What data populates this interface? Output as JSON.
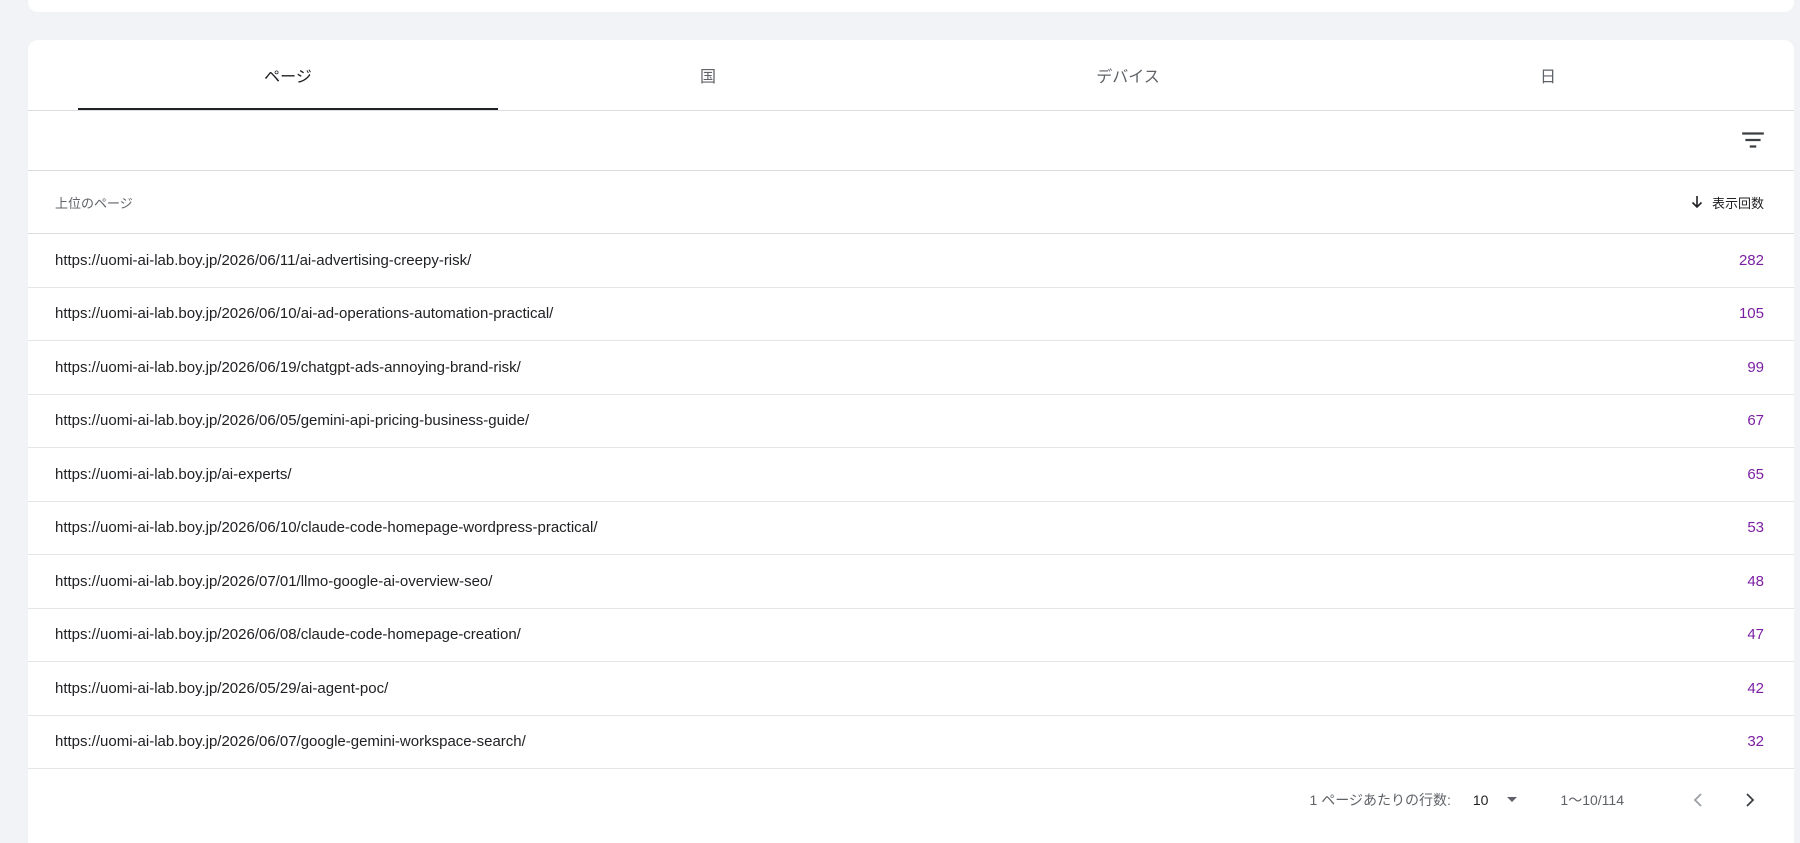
{
  "tabs": [
    {
      "label": "ページ",
      "active": true
    },
    {
      "label": "国",
      "active": false
    },
    {
      "label": "デバイス",
      "active": false
    },
    {
      "label": "日",
      "active": false
    }
  ],
  "table": {
    "column_page": "上位のページ",
    "column_metric": "表示回数",
    "rows": [
      {
        "url": "https://uomi-ai-lab.boy.jp/2026/06/11/ai-advertising-creepy-risk/",
        "value": "282"
      },
      {
        "url": "https://uomi-ai-lab.boy.jp/2026/06/10/ai-ad-operations-automation-practical/",
        "value": "105"
      },
      {
        "url": "https://uomi-ai-lab.boy.jp/2026/06/19/chatgpt-ads-annoying-brand-risk/",
        "value": "99"
      },
      {
        "url": "https://uomi-ai-lab.boy.jp/2026/06/05/gemini-api-pricing-business-guide/",
        "value": "67"
      },
      {
        "url": "https://uomi-ai-lab.boy.jp/ai-experts/",
        "value": "65"
      },
      {
        "url": "https://uomi-ai-lab.boy.jp/2026/06/10/claude-code-homepage-wordpress-practical/",
        "value": "53"
      },
      {
        "url": "https://uomi-ai-lab.boy.jp/2026/07/01/llmo-google-ai-overview-seo/",
        "value": "48"
      },
      {
        "url": "https://uomi-ai-lab.boy.jp/2026/06/08/claude-code-homepage-creation/",
        "value": "47"
      },
      {
        "url": "https://uomi-ai-lab.boy.jp/2026/05/29/ai-agent-poc/",
        "value": "42"
      },
      {
        "url": "https://uomi-ai-lab.boy.jp/2026/06/07/google-gemini-workspace-search/",
        "value": "32"
      }
    ]
  },
  "pagination": {
    "rows_per_page_label": "1 ページあたりの行数:",
    "rows_per_page_value": "10",
    "range": "1〜10/114"
  },
  "icons": {
    "filter": "filter-icon",
    "sort": "arrow-down-icon",
    "dropdown": "caret-down-icon",
    "prev": "chevron-left-icon",
    "next": "chevron-right-icon"
  },
  "colors": {
    "metric_value": "#7b1fa2",
    "active_tab_underline": "#202124"
  }
}
